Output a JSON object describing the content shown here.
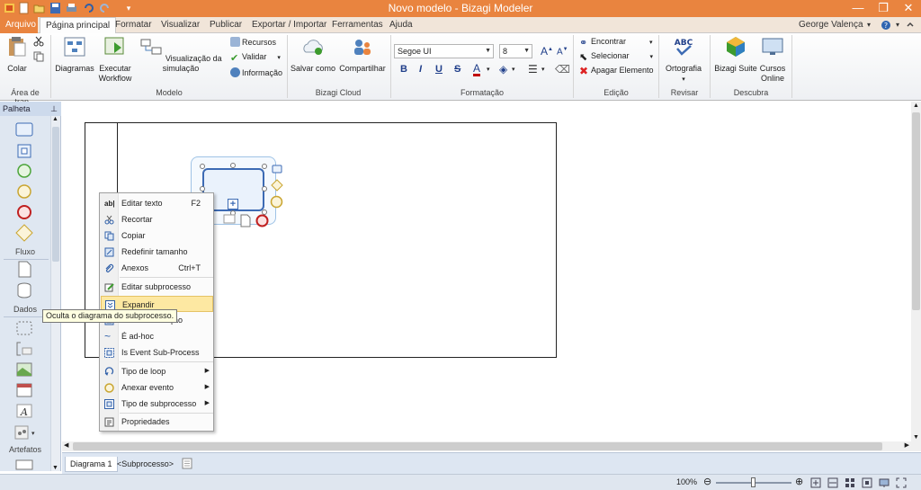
{
  "window": {
    "title": "Novo modelo - Bizagi Modeler",
    "user": "George Valença",
    "colors": {
      "titlebar": "#e9843f",
      "accent_blue": "#203f8a",
      "menu_highlight": "#fde8a2"
    }
  },
  "tabs": [
    {
      "label": "Arquivo"
    },
    {
      "label": "Página principal"
    },
    {
      "label": "Formatar"
    },
    {
      "label": "Visualizar"
    },
    {
      "label": "Publicar"
    },
    {
      "label": "Exportar / Importar"
    },
    {
      "label": "Ferramentas"
    },
    {
      "label": "Ajuda"
    }
  ],
  "ribbon": {
    "clipboard": {
      "paste": "Colar",
      "group": "Área de tran..."
    },
    "modelo": {
      "diagramas": "Diagramas",
      "executar_line1": "Executar",
      "executar_line2": "Workflow",
      "visualizacao": "Visualização da simulação",
      "recursos": "Recursos",
      "validar": "Validar",
      "informacao": "Informação",
      "group": "Modelo"
    },
    "cloud": {
      "salvar": "Salvar como",
      "compartilhar": "Compartilhar",
      "group": "Bizagi Cloud"
    },
    "formatacao": {
      "font": "Segoe UI",
      "size": "8",
      "group": "Formatação",
      "bold": "B",
      "italic": "I",
      "underline": "U",
      "strike": "S"
    },
    "edicao": {
      "encontrar": "Encontrar",
      "selecionar": "Selecionar",
      "apagar": "Apagar Elemento",
      "group": "Edição"
    },
    "revisar": {
      "ortografia": "Ortografia",
      "group": "Revisar"
    },
    "descubra": {
      "suite": "Bizagi Suite",
      "cursos_line1": "Cursos",
      "cursos_line2": "Online",
      "group": "Descubra"
    }
  },
  "palette": {
    "title": "Palheta",
    "fluxo": "Fluxo",
    "dados": "Dados",
    "artefatos": "Artefatos"
  },
  "context_menu": {
    "items": [
      {
        "label": "Editar texto",
        "shortcut": "F2"
      },
      {
        "label": "Recortar"
      },
      {
        "label": "Copiar"
      },
      {
        "label": "Redefinir tamanho"
      },
      {
        "label": "Anexos",
        "shortcut": "Ctrl+T"
      },
      {
        "label": "Editar subprocesso"
      },
      {
        "label": "Expandir"
      },
      {
        "label": "É uma transação"
      },
      {
        "label": "É ad-hoc"
      },
      {
        "label": "Is Event Sub-Process"
      },
      {
        "label": "Tipo de loop"
      },
      {
        "label": "Anexar evento"
      },
      {
        "label": "Tipo de subprocesso"
      },
      {
        "label": "Propriedades"
      }
    ]
  },
  "tooltip": "Oculta o diagrama do subprocesso.",
  "diagram_tabs": [
    {
      "label": "Diagrama 1"
    },
    {
      "label": "<Subprocesso>"
    }
  ],
  "status": {
    "zoom": "100%"
  }
}
